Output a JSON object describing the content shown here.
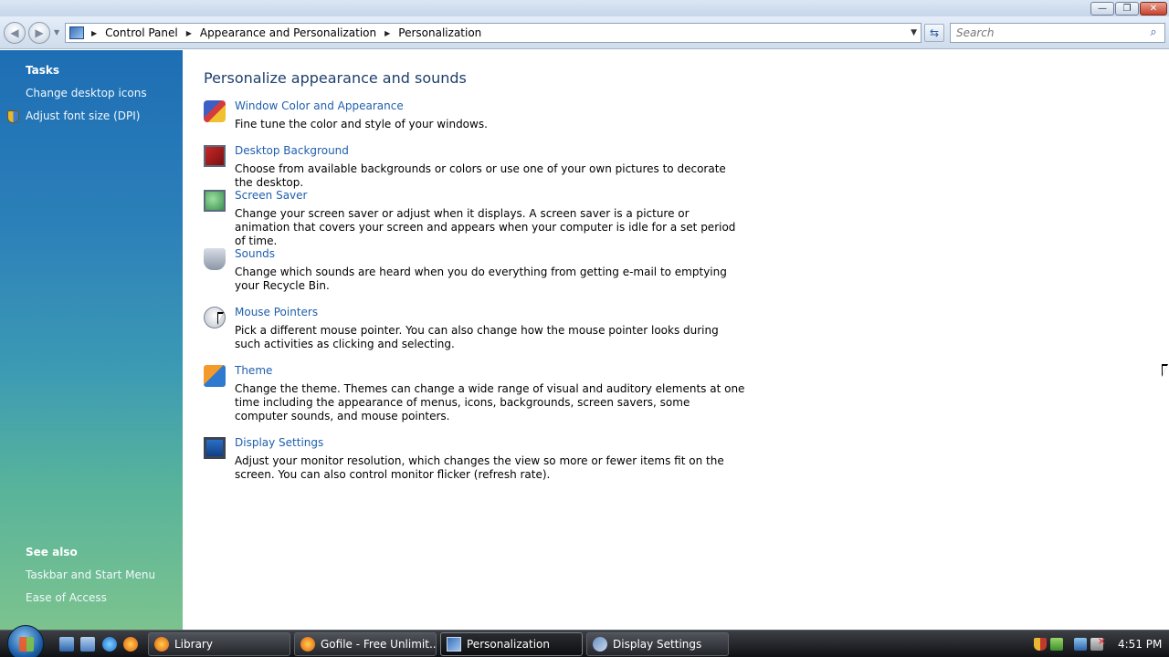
{
  "window": {
    "controls": {
      "minimize": "—",
      "maximize": "❐",
      "close": "✕"
    }
  },
  "navbar": {
    "back_glyph": "◀",
    "forward_glyph": "▶",
    "breadcrumbs": [
      "Control Panel",
      "Appearance and Personalization",
      "Personalization"
    ],
    "search_placeholder": "Search",
    "icons": {
      "back": "back-arrow-icon",
      "forward": "forward-arrow-icon",
      "refresh": "refresh-icon",
      "search": "search-icon"
    }
  },
  "sidebar": {
    "tasks_header": "Tasks",
    "tasks": [
      "Change desktop icons",
      "Adjust font size (DPI)"
    ],
    "see_also_header": "See also",
    "see_also": [
      "Taskbar and Start Menu",
      "Ease of Access"
    ]
  },
  "main": {
    "title": "Personalize appearance and sounds",
    "tasks": [
      {
        "icon": "window-color-icon",
        "link": "Window Color and Appearance",
        "desc": "Fine tune the color and style of your windows."
      },
      {
        "icon": "desktop-background-icon",
        "link": "Desktop Background",
        "desc": "Choose from available backgrounds or colors or use one of your own pictures to decorate the desktop."
      },
      {
        "icon": "screen-saver-icon",
        "link": "Screen Saver",
        "desc": "Change your screen saver or adjust when it displays. A screen saver is a picture or animation that covers your screen and appears when your computer is idle for a set period of time."
      },
      {
        "icon": "sounds-icon",
        "link": "Sounds",
        "desc": "Change which sounds are heard when you do everything from getting e-mail to emptying your Recycle Bin."
      },
      {
        "icon": "mouse-pointers-icon",
        "link": "Mouse Pointers",
        "desc": "Pick a different mouse pointer. You can also change how the mouse pointer looks during such activities as clicking and selecting."
      },
      {
        "icon": "theme-icon",
        "link": "Theme",
        "desc": "Change the theme. Themes can change a wide range of visual and auditory elements at one time including the appearance of menus, icons, backgrounds, screen savers, some computer sounds, and mouse pointers."
      },
      {
        "icon": "display-settings-icon",
        "link": "Display Settings",
        "desc": "Adjust your monitor resolution, which changes the view so more or fewer items fit on the screen. You can also control monitor flicker (refresh rate)."
      }
    ]
  },
  "taskbar": {
    "buttons": [
      {
        "label": "Library",
        "icon": "firefox-icon",
        "active": false
      },
      {
        "label": "Gofile - Free Unlimit...",
        "icon": "firefox-icon",
        "active": false
      },
      {
        "label": "Personalization",
        "icon": "control-panel-icon",
        "active": true
      },
      {
        "label": "Display Settings",
        "icon": "display-settings-icon",
        "active": false
      }
    ],
    "clock": "4:51 PM"
  }
}
